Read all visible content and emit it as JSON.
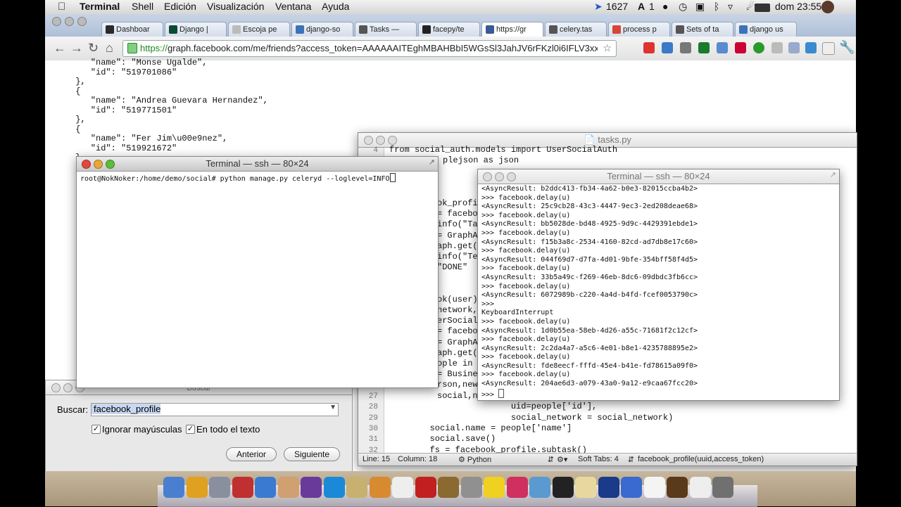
{
  "menubar": {
    "app": "Terminal",
    "items": [
      "Shell",
      "Edición",
      "Visualización",
      "Ventana",
      "Ayuda"
    ],
    "status": {
      "count": "1627",
      "a_count": "1",
      "clock": "dom 23:55"
    }
  },
  "browser": {
    "tabs": [
      {
        "label": "Dashboar",
        "color": "#2a2a2a"
      },
      {
        "label": "Django |",
        "color": "#0c4b33"
      },
      {
        "label": "Escoja pe",
        "color": "#bbbbbb"
      },
      {
        "label": "django-so",
        "color": "#3b73b9"
      },
      {
        "label": "Tasks —",
        "color": "#555555"
      },
      {
        "label": "facepy/te",
        "color": "#222222"
      },
      {
        "label": "https://gr",
        "color": "#3b5998"
      },
      {
        "label": "celery.tas",
        "color": "#555555"
      },
      {
        "label": "process p",
        "color": "#d44638"
      },
      {
        "label": "Sets of ta",
        "color": "#555555"
      },
      {
        "label": "django us",
        "color": "#3b73b9"
      }
    ],
    "url_https": "https://",
    "url_rest": "graph.facebook.com/me/friends?access_token=AAAAAAITEghMBAHBbI5WGsSl3JahJV6rFKzl0i6IFLV3xx8...",
    "json_lines": [
      "         \"name\": \"Monse Ugalde\",",
      "         \"id\": \"519701086\"",
      "      },",
      "      {",
      "         \"name\": \"Andrea Guevara Hernandez\",",
      "         \"id\": \"519771501\"",
      "      },",
      "      {",
      "         \"name\": \"Fer Jim\\u00e9nez\",",
      "         \"id\": \"519921672\"",
      "      },"
    ]
  },
  "terminal_front": {
    "title": "Terminal — ssh — 80×24",
    "prompt": "root@NokNoker:/home/demo/social# python manage.py celeryd --loglevel=INFO"
  },
  "terminal_right": {
    "title": "Terminal — ssh — 80×24",
    "lines": [
      "<AsyncResult: b2ddc413-fb34-4a62-b0e3-82015ccba4b2>",
      ">>> facebook.delay(u)",
      "<AsyncResult: 25c9cb28-43c3-4447-9ec3-2ed208deae68>",
      ">>> facebook.delay(u)",
      "<AsyncResult: bb5028de-bd48-4925-9d9c-4429391ebde1>",
      ">>> facebook.delay(u)",
      "<AsyncResult: f15b3a8c-2534-4160-82cd-ad7db8e17c60>",
      ">>> facebook.delay(u)",
      "<AsyncResult: 044f69d7-d7fa-4d01-9bfe-354bff58f4d5>",
      ">>> facebook.delay(u)",
      "<AsyncResult: 33b5a49c-f269-46eb-8dc6-09dbdc3fb6cc>",
      ">>> facebook.delay(u)",
      "<AsyncResult: 6072989b-c220-4a4d-b4fd-fcef0053790c>",
      ">>>",
      "KeyboardInterrupt",
      ">>> facebook.delay(u)",
      "<AsyncResult: 1d0b55ea-58eb-4d26-a55c-71681f2c12cf>",
      ">>> facebook.delay(u)",
      "<AsyncResult: 2c2da4a7-a5c6-4e01-b8e1-4235788895e2>",
      ">>> facebook.delay(u)",
      "<AsyncResult: fde8eecf-fffd-45e4-b41e-fd78615a09f0>",
      ">>> facebook.delay(u)",
      "<AsyncResult: 204ae6d3-a079-43a0-9a12-e9caa67fcc20>",
      ">>> "
    ]
  },
  "editor": {
    "title": "tasks.py",
    "line4": "from social_auth.models import UserSocialAuth",
    "line5_tail": "plejson as json",
    "left_fragments": [
      "ok_profil",
      "= faceboo",
      "info(\"Ta",
      "= GraphAP",
      "aph.get('",
      "info(\"Te",
      "\"DONE\"",
      "",
      "",
      "ok(user):",
      "network,",
      "erSocialA",
      "= faceboo",
      "= GraphAP",
      "aph.get('",
      "ople in j",
      "= Busines",
      "rson,new",
      "social,new"
    ],
    "bottom_lines": [
      {
        "n": "27",
        "code": ""
      },
      {
        "n": "28",
        "code": "                        uid=people['id'],"
      },
      {
        "n": "29",
        "code": "                        social_network = social_network)"
      },
      {
        "n": "30",
        "code": "        social.name = people['name']"
      },
      {
        "n": "31",
        "code": "        social.save()"
      },
      {
        "n": "32",
        "code": "        fs = facebook_profile.subtask()"
      }
    ],
    "status": {
      "line": "Line: 15",
      "column": "Column: 18",
      "language": "Python",
      "tabs": "Soft Tabs:  4",
      "symbol": "facebook_profile(uuid,access_token)"
    }
  },
  "search_panel": {
    "title": "Buscar",
    "label": "Buscar:",
    "value": "facebook_profile",
    "ignore_case": "Ignorar mayúsculas",
    "whole_text": "En todo el texto",
    "prev": "Anterior",
    "next": "Siguiente"
  },
  "dock": {
    "icon_colors": [
      "#4a7fd0",
      "#e0a020",
      "#8a8fa0",
      "#c03030",
      "#3a7ad0",
      "#d0a070",
      "#6a3a9a",
      "#1a8ad8",
      "#c8b070",
      "#d88a30",
      "#eeeeee",
      "#c02020",
      "#8a6a30",
      "#909090",
      "#f0d020",
      "#d03060",
      "#5a9ad0",
      "#222222",
      "#e8d8a0",
      "#1a3a8a",
      "#3a6ad0",
      "#f4f4f4",
      "#5a3a1a",
      "#eeeeee",
      "#707070"
    ]
  }
}
